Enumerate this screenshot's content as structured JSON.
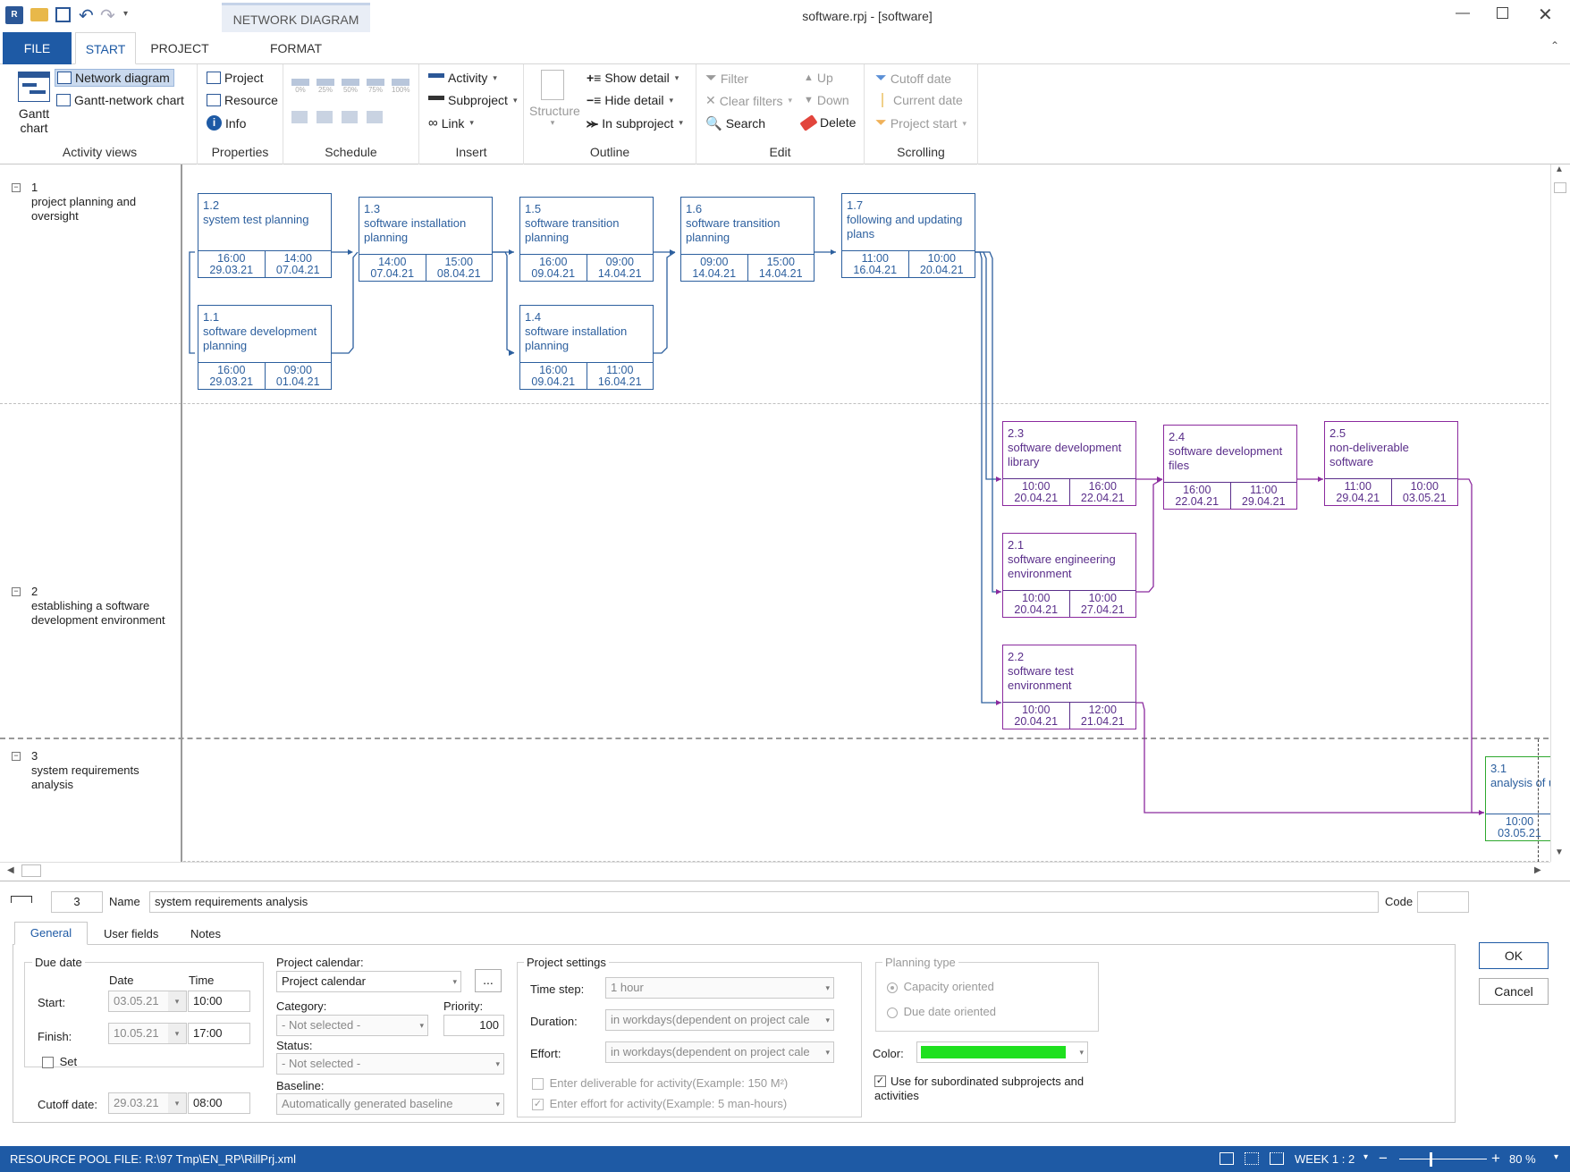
{
  "window": {
    "title": "software.rpj - [software]",
    "contextual_tab": "NETWORK DIAGRAM"
  },
  "tabs": {
    "file": "FILE",
    "start": "START",
    "project": "PROJECT",
    "format": "FORMAT"
  },
  "ribbon": {
    "activity_views": {
      "label": "Activity views",
      "gantt_line1": "Gantt",
      "gantt_line2": "chart",
      "network_diagram": "Network diagram",
      "gantt_network": "Gantt-network chart"
    },
    "properties": {
      "label": "Properties",
      "project": "Project",
      "resource": "Resource",
      "info": "Info"
    },
    "schedule": {
      "label": "Schedule",
      "pct": [
        "0%",
        "25%",
        "50%",
        "75%",
        "100%"
      ]
    },
    "insert": {
      "label": "Insert",
      "activity": "Activity",
      "subproject": "Subproject",
      "link": "Link"
    },
    "outline": {
      "label": "Outline",
      "structure": "Structure",
      "show_detail": "Show detail",
      "hide_detail": "Hide detail",
      "in_subproject": "In subproject"
    },
    "edit": {
      "label": "Edit",
      "filter": "Filter",
      "clear_filters": "Clear filters",
      "search": "Search",
      "up": "Up",
      "down": "Down",
      "delete": "Delete"
    },
    "scrolling": {
      "label": "Scrolling",
      "cutoff_date": "Cutoff date",
      "current_date": "Current date",
      "project_start": "Project start"
    }
  },
  "lanes": [
    {
      "num": "1",
      "title": "project planning and oversight"
    },
    {
      "num": "2",
      "title": "establishing a software development environment"
    },
    {
      "num": "3",
      "title": "system requirements analysis"
    }
  ],
  "nodes": [
    {
      "id": "1.2",
      "name": "system test planning",
      "d1t": "16:00",
      "d1d": "29.03.21",
      "d2t": "14:00",
      "d2d": "07.04.21"
    },
    {
      "id": "1.1",
      "name": "software development planning",
      "d1t": "16:00",
      "d1d": "29.03.21",
      "d2t": "09:00",
      "d2d": "01.04.21"
    },
    {
      "id": "1.3",
      "name": "software installation planning",
      "d1t": "14:00",
      "d1d": "07.04.21",
      "d2t": "15:00",
      "d2d": "08.04.21"
    },
    {
      "id": "1.5",
      "name": "software transition planning",
      "d1t": "16:00",
      "d1d": "09.04.21",
      "d2t": "09:00",
      "d2d": "14.04.21"
    },
    {
      "id": "1.4",
      "name": "software installation planning",
      "d1t": "16:00",
      "d1d": "09.04.21",
      "d2t": "11:00",
      "d2d": "16.04.21"
    },
    {
      "id": "1.6",
      "name": "software transition planning",
      "d1t": "09:00",
      "d1d": "14.04.21",
      "d2t": "15:00",
      "d2d": "14.04.21"
    },
    {
      "id": "1.7",
      "name": "following and updating plans",
      "d1t": "11:00",
      "d1d": "16.04.21",
      "d2t": "10:00",
      "d2d": "20.04.21"
    },
    {
      "id": "2.3",
      "name": "software development library",
      "d1t": "10:00",
      "d1d": "20.04.21",
      "d2t": "16:00",
      "d2d": "22.04.21"
    },
    {
      "id": "2.1",
      "name": "software engineering environment",
      "d1t": "10:00",
      "d1d": "20.04.21",
      "d2t": "10:00",
      "d2d": "27.04.21"
    },
    {
      "id": "2.2",
      "name": "software test environment",
      "d1t": "10:00",
      "d1d": "20.04.21",
      "d2t": "12:00",
      "d2d": "21.04.21"
    },
    {
      "id": "2.4",
      "name": "software development files",
      "d1t": "16:00",
      "d1d": "22.04.21",
      "d2t": "11:00",
      "d2d": "29.04.21"
    },
    {
      "id": "2.5",
      "name": "non-deliverable software",
      "d1t": "11:00",
      "d1d": "29.04.21",
      "d2t": "10:00",
      "d2d": "03.05.21"
    },
    {
      "id": "3.1",
      "name": "analysis of u",
      "d1t": "10:00",
      "d1d": "03.05.21",
      "d2t": "",
      "d2d": ""
    }
  ],
  "editor": {
    "number": "3",
    "name_label": "Name",
    "name_value": "system requirements analysis",
    "code_label": "Code",
    "code_value": "",
    "tabs": [
      "General",
      "User fields",
      "Notes"
    ],
    "due_date": {
      "legend": "Due date",
      "date_hdr": "Date",
      "time_hdr": "Time",
      "start_label": "Start:",
      "start_date": "03.05.21",
      "start_time": "10:00",
      "finish_label": "Finish:",
      "finish_date": "10.05.21",
      "finish_time": "17:00",
      "set_label": "Set"
    },
    "cutoff_label": "Cutoff date:",
    "cutoff_date": "29.03.21",
    "cutoff_time": "08:00",
    "project_calendar_label": "Project calendar:",
    "project_calendar_value": "Project calendar",
    "ellipsis": "...",
    "category_label": "Category:",
    "category_value": "- Not selected -",
    "priority_label": "Priority:",
    "priority_value": "100",
    "status_label": "Status:",
    "status_value": "- Not selected -",
    "baseline_label": "Baseline:",
    "baseline_value": "Automatically generated baseline",
    "settings": {
      "legend": "Project settings",
      "timestep_label": "Time step:",
      "timestep_value": "1 hour",
      "duration_label": "Duration:",
      "duration_value": "in workdays(dependent on project cale",
      "effort_label": "Effort:",
      "effort_value": "in workdays(dependent on project cale",
      "deliverable": "Enter deliverable for activity(Example: 150 M²)",
      "effort_chk": "Enter effort for activity(Example: 5 man-hours)"
    },
    "planning": {
      "legend": "Planning type",
      "capacity": "Capacity oriented",
      "due": "Due date oriented"
    },
    "color_label": "Color:",
    "color_value": "#1ee01e",
    "use_subordinated": "Use for subordinated subprojects and activities",
    "ok": "OK",
    "cancel": "Cancel"
  },
  "status": {
    "resource_pool": "RESOURCE POOL FILE: R:\\97 Tmp\\EN_RP\\RillPrj.xml",
    "week": "WEEK 1 : 2",
    "zoom": "80 %"
  }
}
